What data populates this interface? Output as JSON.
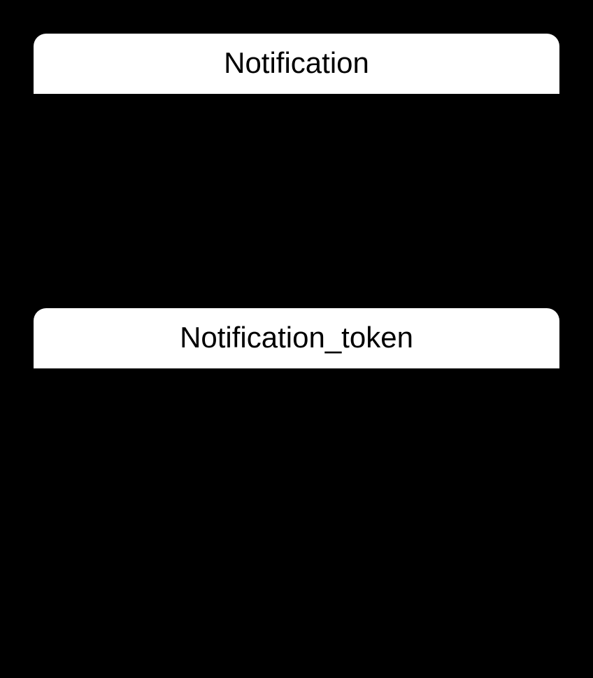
{
  "entities": {
    "notification": {
      "title": "Notification"
    },
    "notification_token": {
      "title": "Notification_token"
    }
  }
}
